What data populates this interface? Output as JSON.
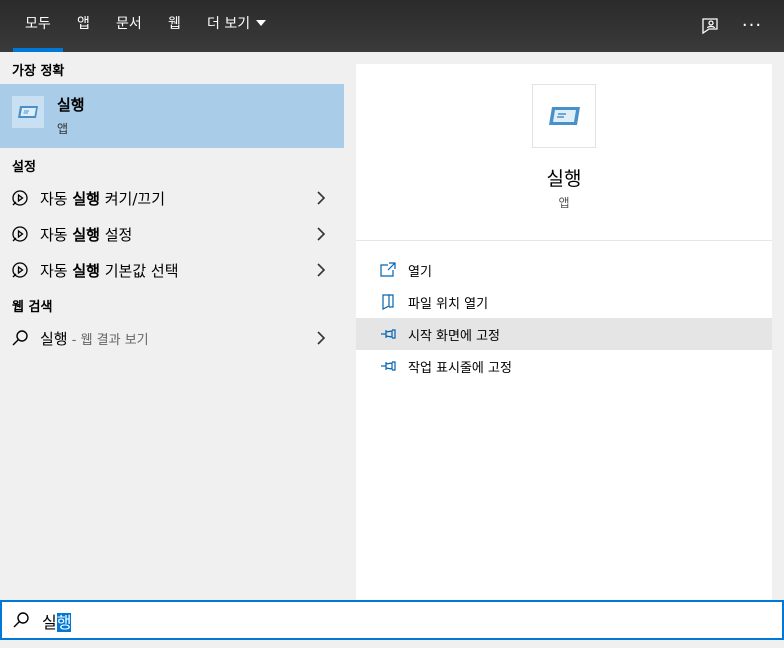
{
  "tabs": [
    {
      "label": "모두",
      "active": true
    },
    {
      "label": "앱"
    },
    {
      "label": "문서"
    },
    {
      "label": "웹"
    },
    {
      "label": "더 보기"
    }
  ],
  "top_icons": [
    "feedback-icon",
    "more-options-icon"
  ],
  "top_more_label": "···",
  "best_match": {
    "header": "가장 정확",
    "title": "실행",
    "subtitle": "앱"
  },
  "settings": {
    "header": "설정",
    "items": [
      {
        "prefix": "자동 ",
        "bold": "실행",
        "suffix": " 켜기/끄기"
      },
      {
        "prefix": "자동 ",
        "bold": "실행",
        "suffix": " 설정"
      },
      {
        "prefix": "자동 ",
        "bold": "실행",
        "suffix": " 기본값 선택"
      }
    ]
  },
  "web_search": {
    "header": "웹 검색",
    "query": "실행",
    "sub": " - 웹 결과 보기"
  },
  "detail": {
    "name": "실행",
    "type": "앱",
    "actions": [
      {
        "label": "열기",
        "icon": "open-icon"
      },
      {
        "label": "파일 위치 열기",
        "icon": "file-location-icon"
      },
      {
        "label": "시작 화면에 고정",
        "icon": "pin-icon",
        "highlighted": true
      },
      {
        "label": "작업 표시줄에 고정",
        "icon": "pin-icon"
      }
    ]
  },
  "search": {
    "typed": "실",
    "selected": "행"
  },
  "colors": {
    "accent": "#0078d7",
    "selection_bg": "#a9cde9",
    "hover_bg": "#e5e5e5"
  }
}
